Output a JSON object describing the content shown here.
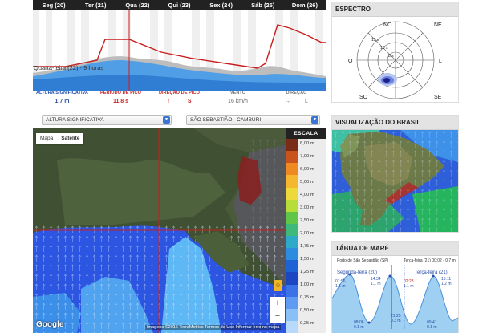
{
  "top_chart": {
    "days": [
      "Seg (20)",
      "Ter (21)",
      "Qua (22)",
      "Qui (23)",
      "Sex (24)",
      "Sáb (25)",
      "Dom (26)"
    ],
    "cursor_label": "Quarta-feira (22) - 9 horas"
  },
  "metrics": [
    {
      "label": "ALTURA SIGNIFICATIVA",
      "value": "1.7 m",
      "color": "blue"
    },
    {
      "label": "PERÍODO DE PICO",
      "value": "11.8 s",
      "color": "red"
    },
    {
      "label": "DIREÇÃO DE PICO",
      "value": "S",
      "color": "red"
    },
    {
      "label": "VENTO",
      "value": "16 km/h",
      "color": "grey"
    },
    {
      "label": "DIREÇÃO",
      "value": "L",
      "color": "grey"
    }
  ],
  "selects": {
    "variable": "ALTURA SIGNIFICATIVA",
    "location": "SÃO SEBASTIÃO - CAMBURI"
  },
  "map": {
    "toggle_map": "Mapa",
    "toggle_satellite": "Satélite",
    "google": "Google",
    "footer": "Imagens ©2016 TerraMetrics    Termos de Uso    Informar erro no mapa",
    "zoom_in": "+",
    "zoom_out": "−"
  },
  "scale": {
    "title": "ESCALA",
    "labels": [
      "8,00 m",
      "7,00 m",
      "6,00 m",
      "5,00 m",
      "4,00 m",
      "3,00 m",
      "2,50 m",
      "2,00 m",
      "1,75 m",
      "1,50 m",
      "1,25 m",
      "1,00 m",
      "0,75 m",
      "0,50 m",
      "0,25 m"
    ],
    "colors": [
      "#7a2c16",
      "#c9531c",
      "#ef8a22",
      "#f6b730",
      "#ecd93a",
      "#b7dd3b",
      "#5fc64a",
      "#3fb979",
      "#2fa9c8",
      "#2d8be0",
      "#1f62d6",
      "#1d47c2",
      "#3b73e7",
      "#5f9bf2",
      "#89c0f5",
      "#b8d9fa"
    ]
  },
  "espectro": {
    "title": "ESPECTRO",
    "directions": [
      "NO",
      "NE",
      "O",
      "L",
      "SO",
      "SE"
    ],
    "periods": [
      "15 s",
      "10 s",
      "5 s"
    ]
  },
  "brasil": {
    "title": "VISUALIZAÇÃO DO BRASIL"
  },
  "mare": {
    "title": "TÁBUA DE MARÉ",
    "port": "Porto de São Sebastião (SP)",
    "now": "Terça-feira (21) 00:02 - 0.7 m",
    "day1": "Segunda-feira (20)",
    "day2": "Terça-feira (21)",
    "highs": [
      {
        "time": "01:56",
        "height": "1.1 m"
      },
      {
        "time": "14:34",
        "height": "1.1 m"
      },
      {
        "time": "02:28",
        "height": "1.1 m"
      },
      {
        "time": "15:11",
        "height": "1.2 m"
      }
    ],
    "lows": [
      {
        "time": "08:06",
        "height": "0.1 m"
      },
      {
        "time": "21:25",
        "height": "0.3 m"
      },
      {
        "time": "09:41",
        "height": "0.1 m"
      }
    ]
  }
}
